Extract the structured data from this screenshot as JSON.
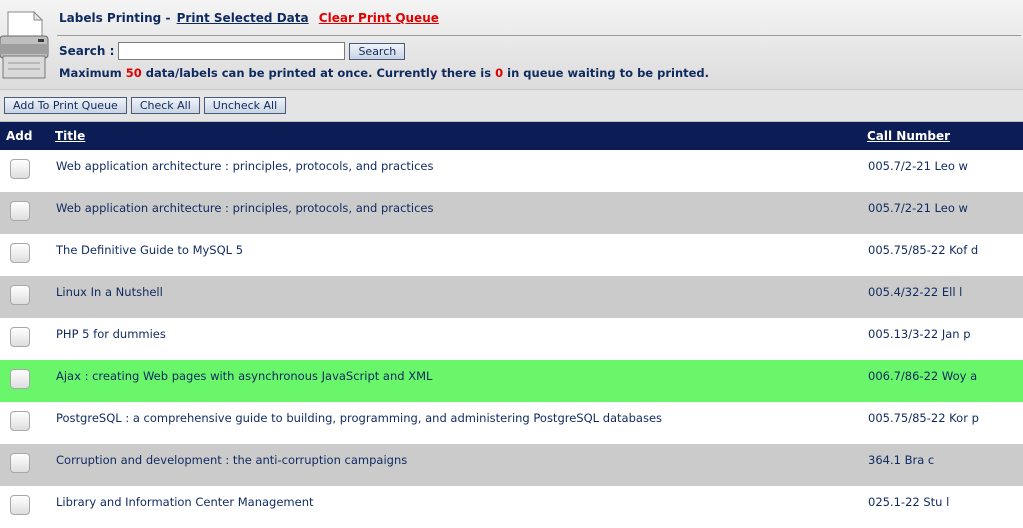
{
  "header": {
    "app_title": "Labels Printing",
    "separator": "-",
    "print_selected": "Print Selected Data",
    "clear_queue": "Clear Print Queue"
  },
  "search": {
    "label": "Search :",
    "value": "",
    "placeholder": "",
    "button": "Search"
  },
  "limits": {
    "prefix": "Maximum",
    "max_count": "50",
    "mid": "data/labels can be printed at once. Currently there is",
    "queue_count": "0",
    "suffix": "in queue waiting to be printed."
  },
  "toolbar": {
    "add_to_queue": "Add To Print Queue",
    "check_all": "Check All",
    "uncheck_all": "Uncheck All"
  },
  "table": {
    "columns": {
      "add": "Add",
      "title": "Title",
      "call_number": "Call Number"
    },
    "rows": [
      {
        "title": "Web application architecture : principles, protocols, and practices",
        "call_number": "005.7/2-21 Leo w",
        "checked": false
      },
      {
        "title": "Web application architecture : principles, protocols, and practices",
        "call_number": "005.7/2-21 Leo w",
        "checked": false
      },
      {
        "title": "The Definitive Guide to MySQL 5",
        "call_number": "005.75/85-22 Kof d",
        "checked": false
      },
      {
        "title": "Linux In a Nutshell",
        "call_number": "005.4/32-22 Ell l",
        "checked": false
      },
      {
        "title": "PHP 5 for dummies",
        "call_number": "005.13/3-22 Jan p",
        "checked": false
      },
      {
        "title": "Ajax : creating Web pages with asynchronous JavaScript and XML",
        "call_number": "006.7/86-22 Woy a",
        "checked": false,
        "highlighted": true
      },
      {
        "title": "PostgreSQL : a comprehensive guide to building, programming, and administering PostgreSQL databases",
        "call_number": "005.75/85-22 Kor p",
        "checked": false
      },
      {
        "title": "Corruption and development : the anti-corruption campaigns",
        "call_number": "364.1 Bra c",
        "checked": false
      },
      {
        "title": "Library and Information Center Management",
        "call_number": "025.1-22 Stu l",
        "checked": false
      }
    ]
  },
  "colors": {
    "header_bar": "#0c1d55",
    "row_alt": "#cbcbcb",
    "row_highlight": "#69f66b",
    "alert_red": "#e00000",
    "text": "#0f2a5f"
  },
  "icons": {
    "printer": "printer-icon"
  }
}
